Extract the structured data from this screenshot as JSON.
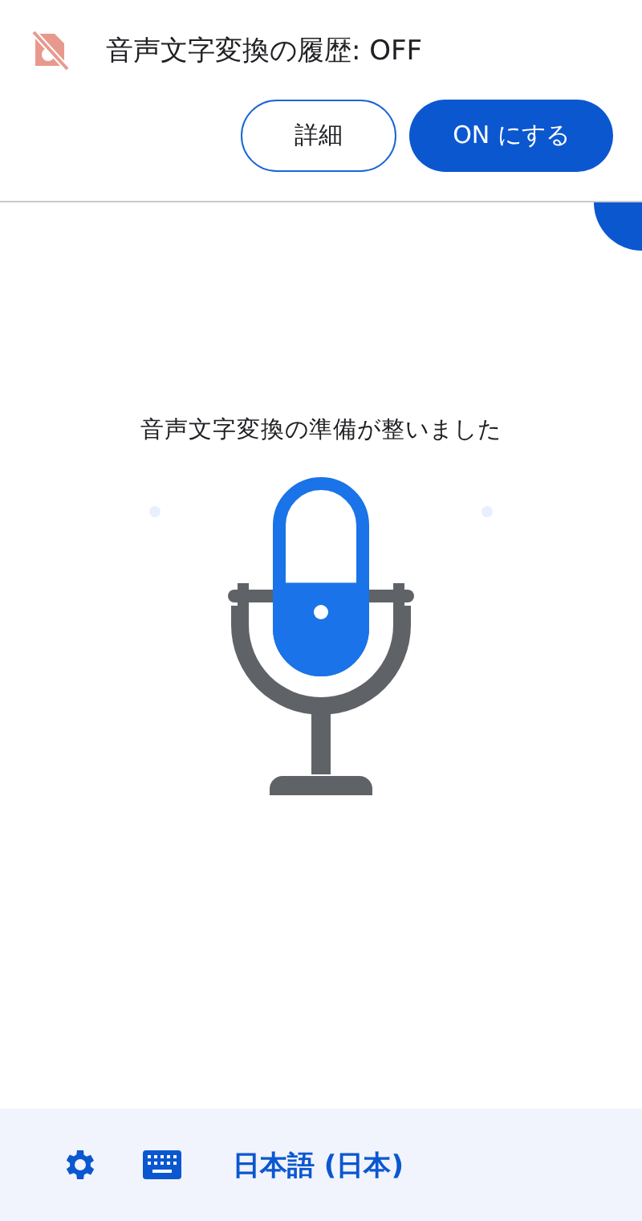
{
  "header": {
    "title": "音声文字変換の履歴: OFF",
    "buttons": [
      {
        "label": "詳細",
        "kind": "outlined"
      },
      {
        "label": "ON にする",
        "kind": "filled"
      }
    ]
  },
  "main": {
    "status": "音声文字変換の準備が整いました",
    "mic": {
      "level": 0.47
    }
  },
  "bottom_bar": {
    "language": "日本語 (日本)"
  }
}
